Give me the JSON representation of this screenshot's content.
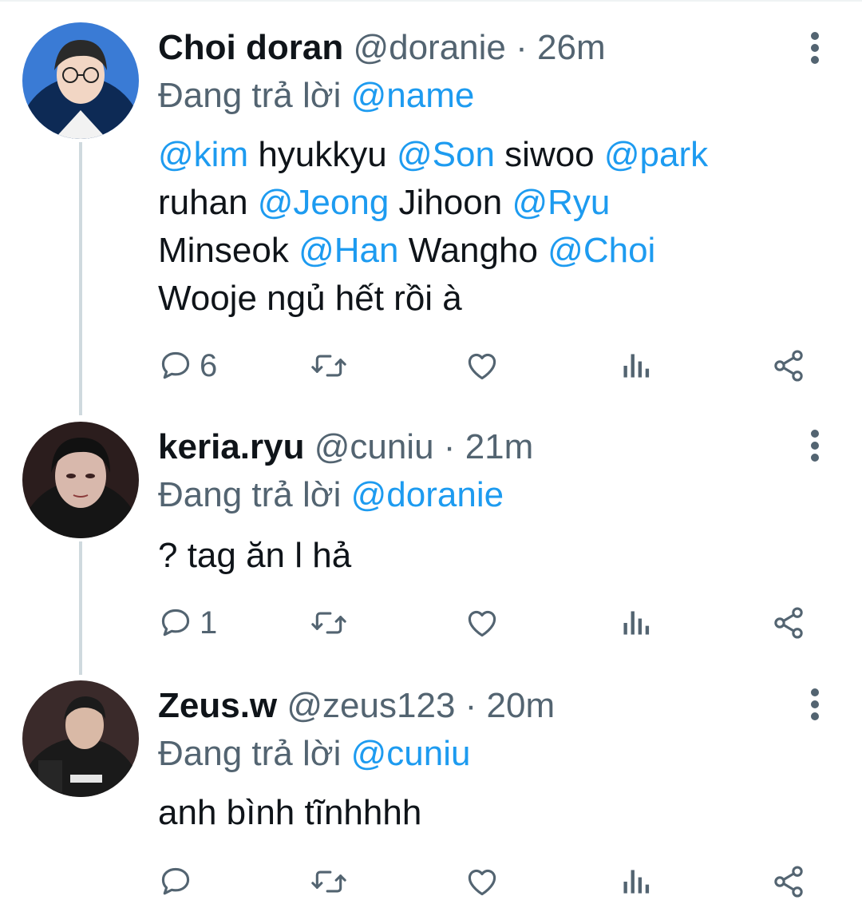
{
  "tweets": [
    {
      "display_name": "Choi doran",
      "handle": "@doranie",
      "dot": "·",
      "time": "26m",
      "reply_prefix": "Đang trả lời",
      "reply_to": "@name",
      "body": {
        "l1": [
          {
            "m": "@kim"
          },
          {
            "t": " hyukkyu "
          },
          {
            "m": "@Son"
          },
          {
            "t": " siwoo "
          },
          {
            "m": "@park"
          }
        ],
        "l2": [
          {
            "t": "ruhan "
          },
          {
            "m": "@Jeong"
          },
          {
            "t": " Jihoon "
          },
          {
            "m": "@Ryu"
          }
        ],
        "l3": [
          {
            "t": "Minseok "
          },
          {
            "m": "@Han"
          },
          {
            "t": " Wangho "
          },
          {
            "m": "@Choi"
          }
        ],
        "l4": [
          {
            "t": "Wooje ngủ hết rồi à"
          }
        ]
      },
      "reply_count": "6"
    },
    {
      "display_name": "keria.ryu",
      "handle": "@cuniu",
      "dot": "·",
      "time": "21m",
      "reply_prefix": "Đang trả lời",
      "reply_to": "@doranie",
      "body_text": "? tag ăn l hả",
      "reply_count": "1"
    },
    {
      "display_name": "Zeus.w",
      "handle": "@zeus123",
      "dot": "·",
      "time": "20m",
      "reply_prefix": "Đang trả lời",
      "reply_to": "@cuniu",
      "body_text": "anh bình tĩnhhhh",
      "reply_count": ""
    }
  ],
  "icons": {
    "reply": "reply-bubble-icon",
    "retweet": "retweet-icon",
    "like": "heart-icon",
    "views": "analytics-bar-icon",
    "share": "share-icon",
    "more": "more-vertical-icon"
  },
  "colors": {
    "mention": "#1d9bf0",
    "secondary": "#536471",
    "text": "#0f1419",
    "thread_line": "#cfd9de"
  }
}
